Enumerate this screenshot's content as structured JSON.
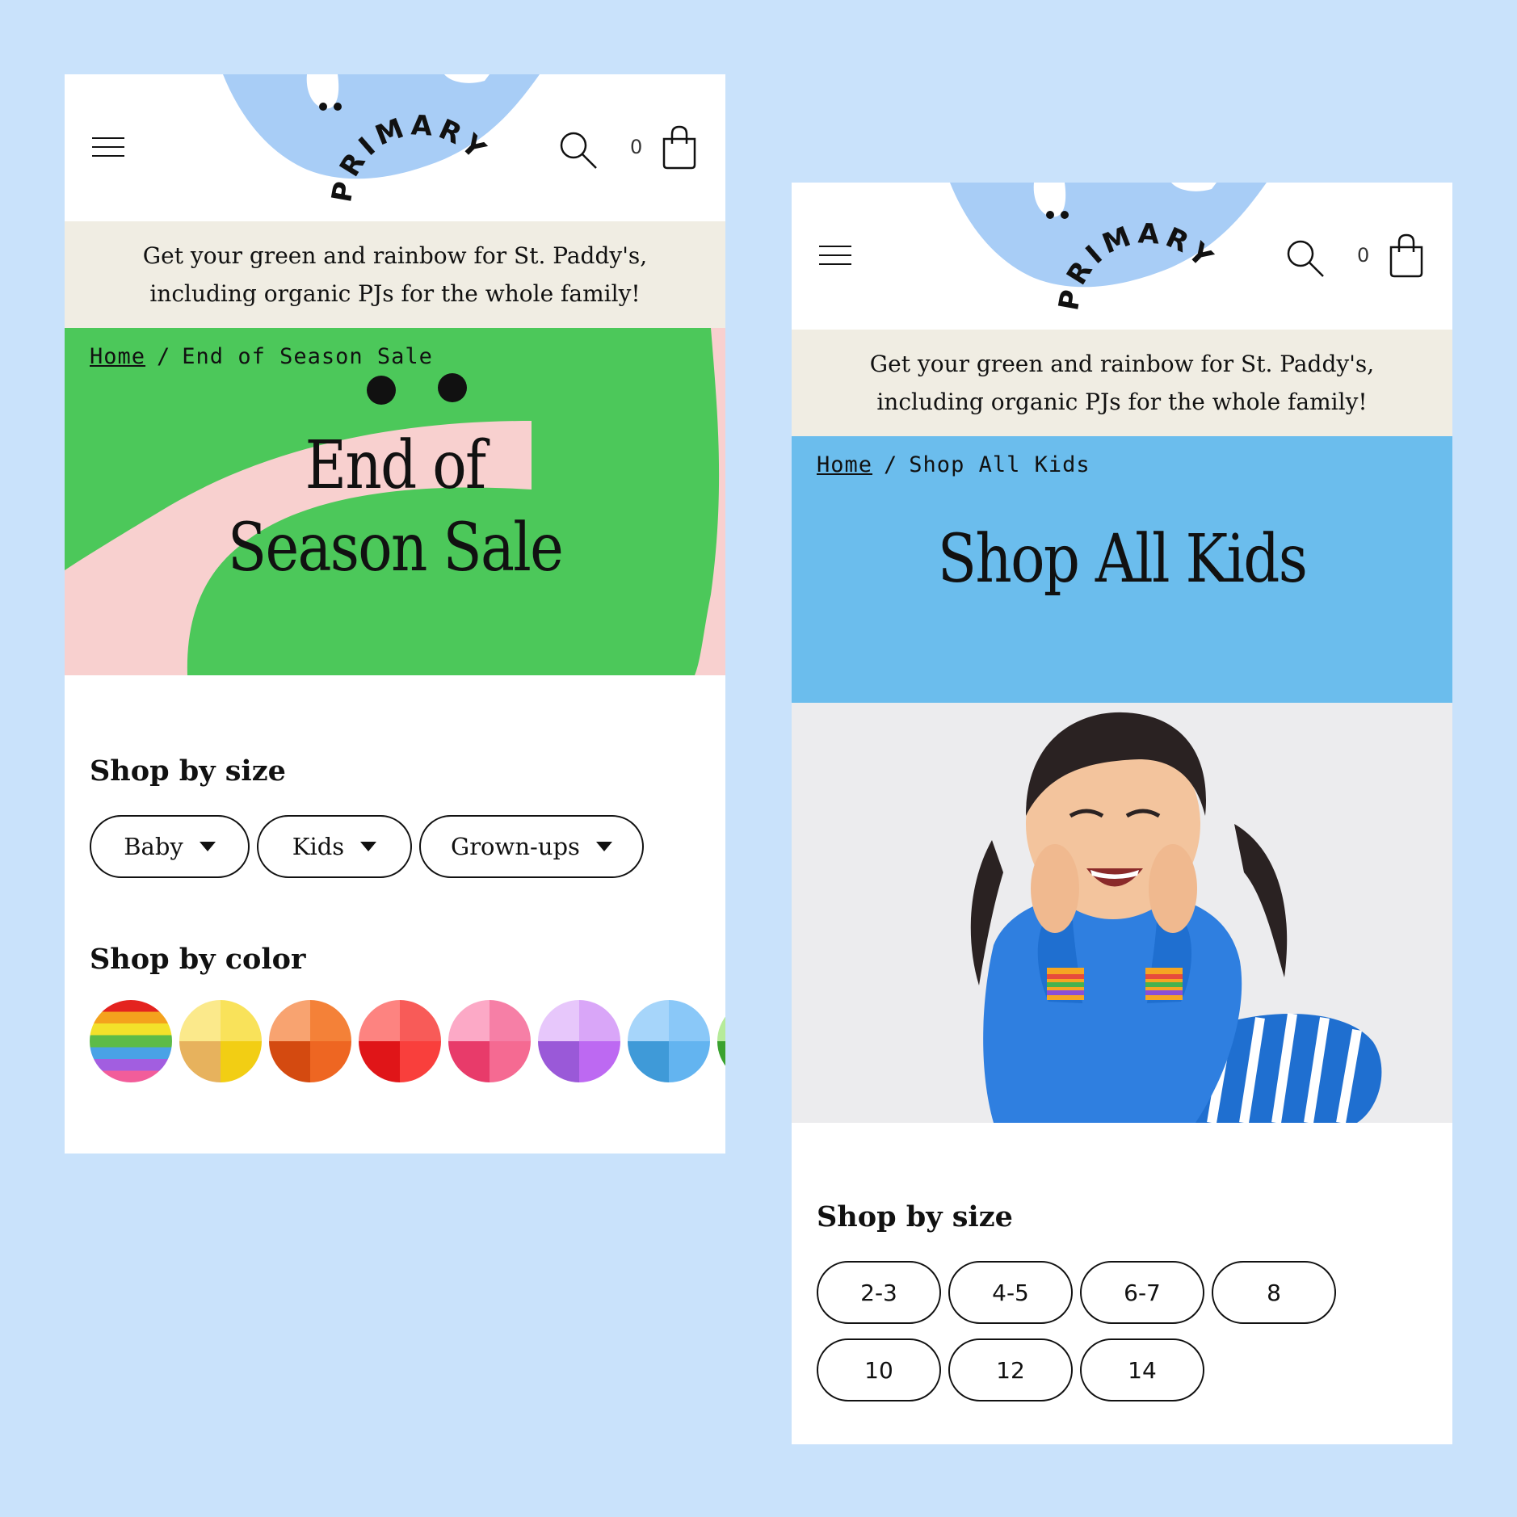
{
  "brand": {
    "logo_text": "PRIMARY",
    "blob_color": "#a8cdf6"
  },
  "header": {
    "cart_count": "0"
  },
  "promo": {
    "text": "Get your green and rainbow for St. Paddy's, including organic PJs for the whole family!"
  },
  "phone1": {
    "breadcrumb": {
      "home": "Home",
      "separator": "/",
      "current": "End of Season Sale"
    },
    "hero": {
      "title": "End of Season Sale",
      "bg_color": "#f8d0cf",
      "shape_color": "#4cc85a"
    },
    "shop_by_size": {
      "title": "Shop by size",
      "options": [
        "Baby",
        "Kids",
        "Grown-ups"
      ]
    },
    "shop_by_color": {
      "title": "Shop by color",
      "swatches": [
        {
          "name": "rainbow",
          "colors": [
            "#e4231f",
            "#f4a21d",
            "#f3e12a",
            "#5dbb48",
            "#49a2e6",
            "#a25ee0",
            "#f25d9a"
          ]
        },
        {
          "name": "yellow",
          "colors": [
            "#fbe98b",
            "#f9e25a",
            "#e7b25d",
            "#f2ce14"
          ]
        },
        {
          "name": "orange",
          "colors": [
            "#f8a370",
            "#f48138",
            "#d44a10",
            "#ee6622"
          ]
        },
        {
          "name": "red",
          "colors": [
            "#fd8380",
            "#f85b58",
            "#e01518",
            "#f93f3c"
          ]
        },
        {
          "name": "pink",
          "colors": [
            "#fca9c6",
            "#f67fa6",
            "#e83b6a",
            "#f56a92"
          ]
        },
        {
          "name": "purple",
          "colors": [
            "#e7c7fb",
            "#d9a6f8",
            "#9a59d8",
            "#bd69f2"
          ]
        },
        {
          "name": "blue",
          "colors": [
            "#a6d5fa",
            "#8ac8f8",
            "#3f9ad8",
            "#63b4f0"
          ]
        },
        {
          "name": "green",
          "colors": [
            "#b6eb9a",
            "#8fdc6e",
            "#3aa22f",
            "#58c447"
          ]
        }
      ]
    }
  },
  "phone2": {
    "breadcrumb": {
      "home": "Home",
      "separator": "/",
      "current": "Shop All Kids"
    },
    "hero": {
      "title": "Shop All Kids",
      "bg_color": "#6bbded"
    },
    "shop_by_size": {
      "title": "Shop by size",
      "options": [
        "2-3",
        "4-5",
        "6-7",
        "8",
        "10",
        "12",
        "14"
      ]
    }
  }
}
